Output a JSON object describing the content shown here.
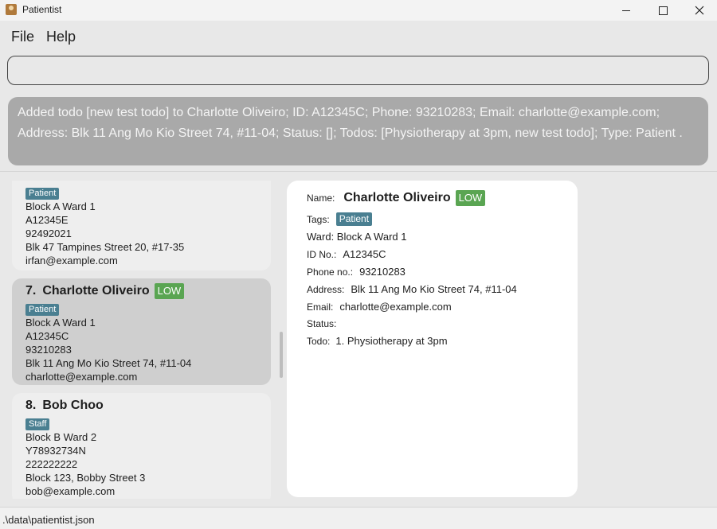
{
  "window": {
    "title": "Patientist"
  },
  "menu": {
    "file": "File",
    "help": "Help"
  },
  "command": {
    "value": "",
    "placeholder": ""
  },
  "result": {
    "text": "Added todo [new test todo] to Charlotte Oliveiro; ID: A12345C; Phone: 93210283; Email: charlotte@example.com; Address: Blk 11 Ang Mo Kio Street 74, #11-04; Status: []; Todos: [Physiotherapy at 3pm, new test todo]; Type: Patient ."
  },
  "list": {
    "cards": [
      {
        "index": "",
        "name": "",
        "tag": "Patient",
        "ward": "Block A Ward 1",
        "id": "A12345E",
        "phone": "92492021",
        "address": "Blk 47 Tampines Street 20, #17-35",
        "email": "irfan@example.com"
      },
      {
        "index": "7.",
        "name": "Charlotte Oliveiro",
        "priority": "LOW",
        "tag": "Patient",
        "ward": "Block A Ward 1",
        "id": "A12345C",
        "phone": "93210283",
        "address": "Blk 11 Ang Mo Kio Street 74, #11-04",
        "email": "charlotte@example.com"
      },
      {
        "index": "8.",
        "name": "Bob Choo",
        "tag": "Staff",
        "ward": "Block B Ward 2",
        "id": "Y78932734N",
        "phone": "222222222",
        "address": "Block 123, Bobby Street 3",
        "email": "bob@example.com"
      }
    ]
  },
  "detail": {
    "name_label": "Name:",
    "name": "Charlotte Oliveiro",
    "priority": "LOW",
    "tags_label": "Tags:",
    "tag": "Patient",
    "ward": "Ward: Block A Ward 1",
    "id_label": "ID No.:",
    "id": "A12345C",
    "phone_label": "Phone no.:",
    "phone": "93210283",
    "address_label": "Address:",
    "address": "Blk 11 Ang Mo Kio Street 74, #11-04",
    "email_label": "Email:",
    "email": "charlotte@example.com",
    "status_label": "Status:",
    "todo_label": "Todo:",
    "todo": "1. Physiotherapy at 3pm"
  },
  "status_bar": {
    "path": ".\\data\\patientist.json"
  },
  "colors": {
    "priority_low": "#5aa552",
    "tag": "#4a7f91",
    "result_bg": "#a9a9a9"
  }
}
